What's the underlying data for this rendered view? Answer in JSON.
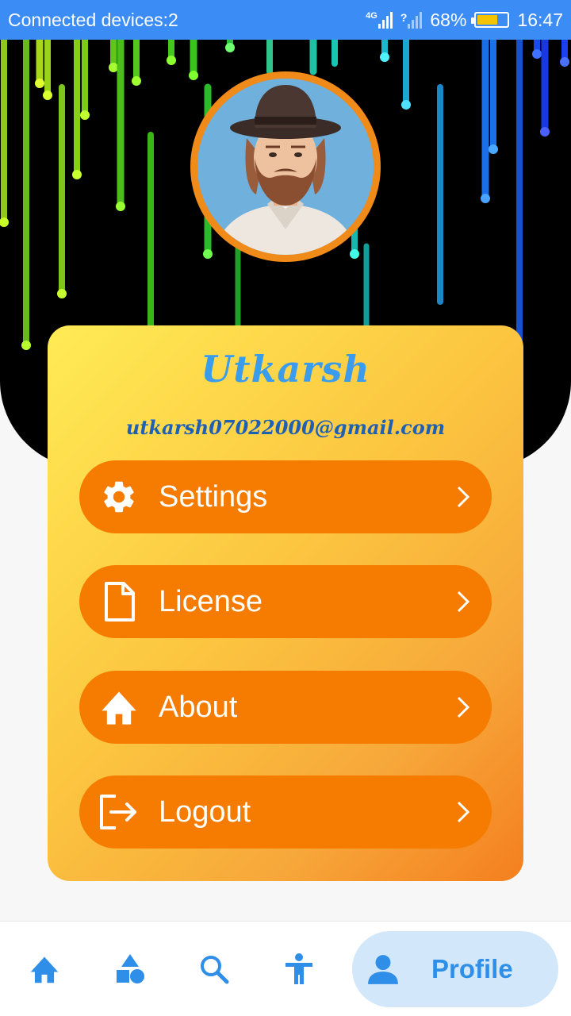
{
  "status_bar": {
    "left_text": "Connected devices:2",
    "network_label": "4G",
    "unknown_label": "?",
    "battery_percent": "68%",
    "battery_level": 0.68,
    "time": "16:47"
  },
  "profile": {
    "name": "Utkarsh",
    "email": "utkarsh07022000@gmail.com",
    "avatar_icon": "avatar-man-in-hat"
  },
  "menu": {
    "items": [
      {
        "label": "Settings",
        "icon": "gear-icon"
      },
      {
        "label": "License",
        "icon": "document-icon"
      },
      {
        "label": "About",
        "icon": "home-icon"
      },
      {
        "label": "Logout",
        "icon": "logout-icon"
      }
    ]
  },
  "bottom_nav": {
    "items": [
      {
        "icon": "home-icon"
      },
      {
        "icon": "shapes-icon"
      },
      {
        "icon": "search-icon"
      },
      {
        "icon": "accessibility-icon"
      },
      {
        "icon": "person-icon",
        "label": "Profile",
        "active": true
      }
    ]
  },
  "colors": {
    "status_bar": "#3b8df5",
    "menu_button": "#f57c00",
    "name_text": "#3a9cec",
    "email_text": "#1f5fb4",
    "nav_active_bg": "#d3e7fb",
    "nav_icon": "#2f8fe8",
    "avatar_ring": "#f08a18"
  }
}
